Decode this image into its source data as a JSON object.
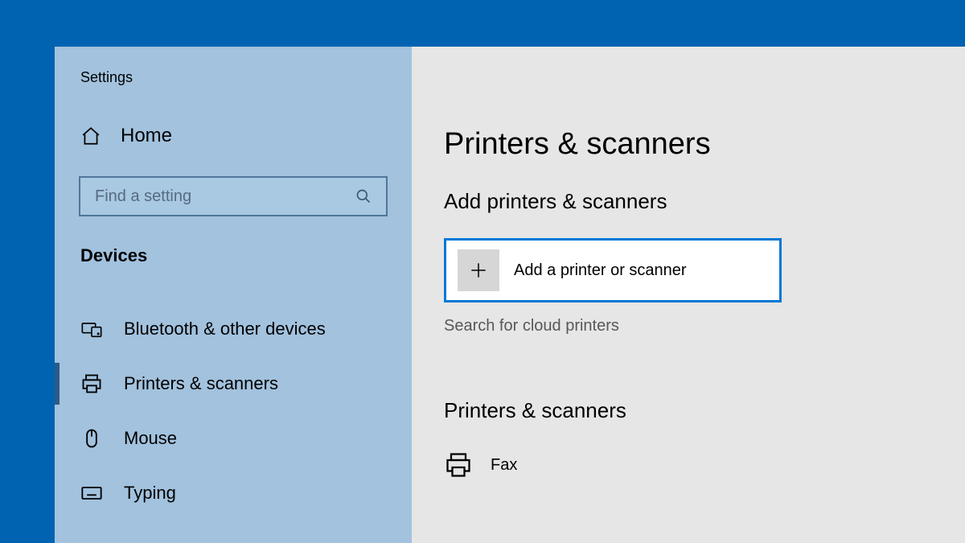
{
  "app_title": "Settings",
  "sidebar": {
    "home_label": "Home",
    "search_placeholder": "Find a setting",
    "category_header": "Devices",
    "items": [
      {
        "label": "Bluetooth & other devices",
        "icon": "bluetooth-devices-icon",
        "selected": false
      },
      {
        "label": "Printers & scanners",
        "icon": "printer-icon",
        "selected": true
      },
      {
        "label": "Mouse",
        "icon": "mouse-icon",
        "selected": false
      },
      {
        "label": "Typing",
        "icon": "keyboard-icon",
        "selected": false
      }
    ]
  },
  "main": {
    "page_title": "Printers & scanners",
    "add_section_title": "Add printers & scanners",
    "add_button_label": "Add a printer or scanner",
    "search_cloud_label": "Search for cloud printers",
    "list_section_title": "Printers & scanners",
    "devices": [
      {
        "label": "Fax",
        "icon": "printer-icon"
      }
    ]
  },
  "colors": {
    "desktop": "#0063b1",
    "sidebar": "#a2c2de",
    "content": "#e6e6e6",
    "accent": "#0078d4"
  }
}
